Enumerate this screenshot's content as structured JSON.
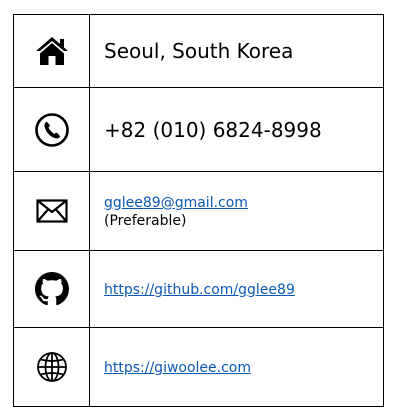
{
  "contact": {
    "location": "Seoul, South Korea",
    "phone": "+82 (010) 6824-8998",
    "email": "gglee89@gmail.com",
    "email_note": "(Preferable)",
    "github": "https://github.com/gglee89",
    "website": "https://giwoolee.com"
  },
  "icons": {
    "location": "home-icon",
    "phone": "phone-icon",
    "email": "envelope-icon",
    "github": "github-icon",
    "website": "globe-icon"
  }
}
